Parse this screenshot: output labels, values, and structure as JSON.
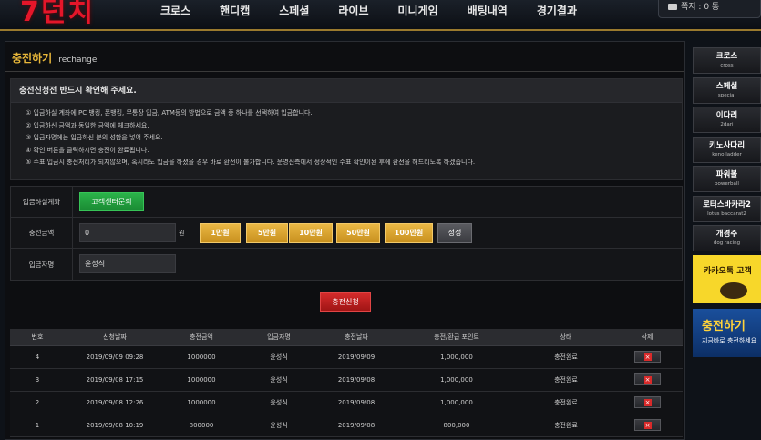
{
  "brand": {
    "logo_text": "7던치"
  },
  "nav": {
    "items": [
      "크로스",
      "핸디캡",
      "스페셜",
      "라이브",
      "미니게임",
      "배팅내역",
      "경기결과"
    ]
  },
  "user": {
    "message_label": "쪽지 : 0 통"
  },
  "page": {
    "title": "충전하기",
    "subtitle": "rechange"
  },
  "notice": {
    "title": "충전신청전 반드시 확인해 주세요.",
    "lines": [
      "① 입금하실 계좌에 PC 뱅킹, 폰뱅킹, 무통장 입금, ATM등의 방법으로 금액 중 하나를 선택하여 입금합니다.",
      "② 입금하신 금액과 동일한 금액에 체크하세요.",
      "③ 입금자명에는 입금하신 분의 성함을 넣어 주세요.",
      "④ 확인 버튼을 클릭하시면 충전이 완료됩니다.",
      "⑤ 수표 입금시 충전처리가 되지않으며, 혹시라도 입금을 하셨을 경우 바로 환전이 불가합니다. 운영진측에서 정상적인 수표 확인이된 후에 환전을 해드리도록 하겠습니다."
    ]
  },
  "form": {
    "account_label": "입금하실계좌",
    "support_button": "고객센터문의",
    "amount_label": "충전금액",
    "amount_value": "0",
    "currency": "원",
    "quick_amounts": [
      "1만원",
      "5만원",
      "10만원",
      "50만원",
      "100만원"
    ],
    "reset_button": "정정",
    "depositor_label": "입금자명",
    "depositor_value": "윤성식",
    "submit_button": "충전신청"
  },
  "table": {
    "headers": [
      "번호",
      "신청날짜",
      "충전금액",
      "입금자명",
      "충전날짜",
      "충전/환급 포인트",
      "상태",
      "삭제"
    ],
    "rows": [
      {
        "no": "4",
        "request_date": "2019/09/09 09:28",
        "amount": "1000000",
        "depositor": "윤성식",
        "charge_date": "2019/09/09",
        "points": "1,000,000",
        "status": "충전완료"
      },
      {
        "no": "3",
        "request_date": "2019/09/08 17:15",
        "amount": "1000000",
        "depositor": "윤성식",
        "charge_date": "2019/09/08",
        "points": "1,000,000",
        "status": "충전완료"
      },
      {
        "no": "2",
        "request_date": "2019/09/08 12:26",
        "amount": "1000000",
        "depositor": "윤성식",
        "charge_date": "2019/09/08",
        "points": "1,000,000",
        "status": "충전완료"
      },
      {
        "no": "1",
        "request_date": "2019/09/08 10:19",
        "amount": "800000",
        "depositor": "윤성식",
        "charge_date": "2019/09/08",
        "points": "800,000",
        "status": "충전완료"
      }
    ],
    "delete_glyph": "×"
  },
  "sidebar": {
    "items": [
      {
        "ko": "크로스",
        "en": "cross"
      },
      {
        "ko": "스페셜",
        "en": "special"
      },
      {
        "ko": "이다리",
        "en": "2dari"
      },
      {
        "ko": "키노사다리",
        "en": "keno ladder"
      },
      {
        "ko": "파워볼",
        "en": "powerball"
      },
      {
        "ko": "로터스바카라2",
        "en": "lotus baccarat2"
      },
      {
        "ko": "개경주",
        "en": "dog racing"
      }
    ],
    "banner_kakao": "카카오톡 고객",
    "banner_charge_title": "충전하기",
    "banner_charge_sub": "지금바로 충전하세요"
  },
  "colors": {
    "accent_gold": "#e8b73a",
    "brand_red": "#e4162a",
    "support_green": "#1a8a33",
    "submit_red": "#a01515"
  }
}
